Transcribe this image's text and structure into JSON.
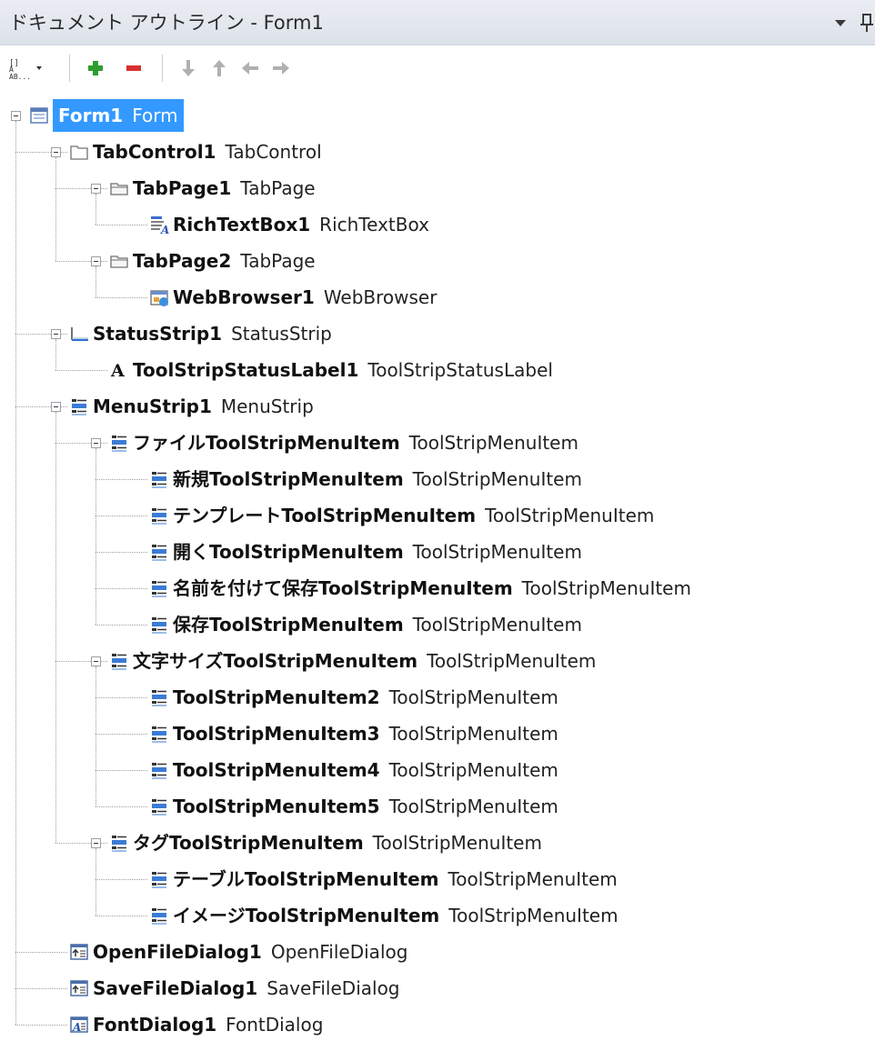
{
  "window": {
    "title": "ドキュメント アウトライン - Form1"
  },
  "toolbar": {
    "buttons": [
      {
        "name": "sort-view-dropdown",
        "icon": "text-view-icon"
      },
      {
        "name": "add-button",
        "icon": "plus-icon",
        "color": "#2e9e2e"
      },
      {
        "name": "remove-button",
        "icon": "minus-icon",
        "color": "#d93030"
      },
      {
        "name": "move-down-button",
        "icon": "arrow-down-icon"
      },
      {
        "name": "move-up-button",
        "icon": "arrow-up-icon"
      },
      {
        "name": "move-left-button",
        "icon": "arrow-left-icon"
      },
      {
        "name": "move-right-button",
        "icon": "arrow-right-icon"
      }
    ]
  },
  "selection_color": "#3399ff",
  "tree": [
    {
      "id": "form1",
      "level": 0,
      "expandable": true,
      "icon": "form",
      "name": "Form1",
      "type": "Form",
      "selected": true
    },
    {
      "id": "tabcontrol1",
      "level": 1,
      "expandable": true,
      "icon": "tabcontrol",
      "name": "TabControl1",
      "type": "TabControl"
    },
    {
      "id": "tabpage1",
      "level": 2,
      "expandable": true,
      "icon": "tabpage",
      "name": "TabPage1",
      "type": "TabPage"
    },
    {
      "id": "richtextbox1",
      "level": 3,
      "expandable": false,
      "icon": "richtextbox",
      "name": "RichTextBox1",
      "type": "RichTextBox"
    },
    {
      "id": "tabpage2",
      "level": 2,
      "expandable": true,
      "icon": "tabpage",
      "name": "TabPage2",
      "type": "TabPage"
    },
    {
      "id": "webbrowser1",
      "level": 3,
      "expandable": false,
      "icon": "webbrowser",
      "name": "WebBrowser1",
      "type": "WebBrowser"
    },
    {
      "id": "statusstrip1",
      "level": 1,
      "expandable": true,
      "icon": "statusstrip",
      "name": "StatusStrip1",
      "type": "StatusStrip"
    },
    {
      "id": "toolstripstatuslabel1",
      "level": 2,
      "expandable": false,
      "icon": "label",
      "name": "ToolStripStatusLabel1",
      "type": "ToolStripStatusLabel"
    },
    {
      "id": "menustrip1",
      "level": 1,
      "expandable": true,
      "icon": "menu",
      "name": "MenuStrip1",
      "type": "MenuStrip"
    },
    {
      "id": "file-item",
      "level": 2,
      "expandable": true,
      "icon": "menu",
      "name": "ファイルToolStripMenuItem",
      "type": "ToolStripMenuItem"
    },
    {
      "id": "new-item",
      "level": 3,
      "expandable": false,
      "icon": "menu",
      "name": "新規ToolStripMenuItem",
      "type": "ToolStripMenuItem"
    },
    {
      "id": "template-item",
      "level": 3,
      "expandable": false,
      "icon": "menu",
      "name": "テンプレートToolStripMenuItem",
      "type": "ToolStripMenuItem"
    },
    {
      "id": "open-item",
      "level": 3,
      "expandable": false,
      "icon": "menu",
      "name": "開くToolStripMenuItem",
      "type": "ToolStripMenuItem"
    },
    {
      "id": "saveas-item",
      "level": 3,
      "expandable": false,
      "icon": "menu",
      "name": "名前を付けて保存ToolStripMenuItem",
      "type": "ToolStripMenuItem"
    },
    {
      "id": "save-item",
      "level": 3,
      "expandable": false,
      "icon": "menu",
      "name": "保存ToolStripMenuItem",
      "type": "ToolStripMenuItem"
    },
    {
      "id": "fontsize-item",
      "level": 2,
      "expandable": true,
      "icon": "menu",
      "name": "文字サイズToolStripMenuItem",
      "type": "ToolStripMenuItem"
    },
    {
      "id": "tsmi2",
      "level": 3,
      "expandable": false,
      "icon": "menu",
      "name": "ToolStripMenuItem2",
      "type": "ToolStripMenuItem"
    },
    {
      "id": "tsmi3",
      "level": 3,
      "expandable": false,
      "icon": "menu",
      "name": "ToolStripMenuItem3",
      "type": "ToolStripMenuItem"
    },
    {
      "id": "tsmi4",
      "level": 3,
      "expandable": false,
      "icon": "menu",
      "name": "ToolStripMenuItem4",
      "type": "ToolStripMenuItem"
    },
    {
      "id": "tsmi5",
      "level": 3,
      "expandable": false,
      "icon": "menu",
      "name": "ToolStripMenuItem5",
      "type": "ToolStripMenuItem"
    },
    {
      "id": "tag-item",
      "level": 2,
      "expandable": true,
      "icon": "menu",
      "name": "タグToolStripMenuItem",
      "type": "ToolStripMenuItem"
    },
    {
      "id": "table-item",
      "level": 3,
      "expandable": false,
      "icon": "menu",
      "name": "テーブルToolStripMenuItem",
      "type": "ToolStripMenuItem"
    },
    {
      "id": "image-item",
      "level": 3,
      "expandable": false,
      "icon": "menu",
      "name": "イメージToolStripMenuItem",
      "type": "ToolStripMenuItem"
    },
    {
      "id": "openfiledialog1",
      "level": 1,
      "expandable": false,
      "icon": "dialog",
      "name": "OpenFileDialog1",
      "type": "OpenFileDialog"
    },
    {
      "id": "savefiledialog1",
      "level": 1,
      "expandable": false,
      "icon": "dialog",
      "name": "SaveFileDialog1",
      "type": "SaveFileDialog"
    },
    {
      "id": "fontdialog1",
      "level": 1,
      "expandable": false,
      "icon": "fontdialog",
      "name": "FontDialog1",
      "type": "FontDialog"
    }
  ]
}
